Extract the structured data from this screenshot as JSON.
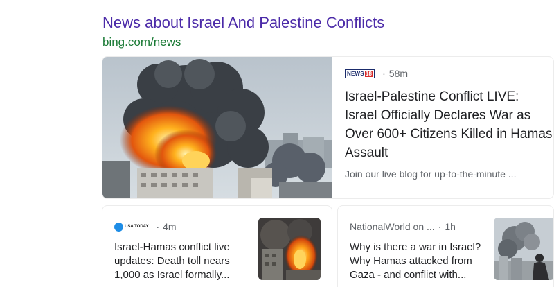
{
  "section": {
    "title": "News about Israel And Palestine Conflicts",
    "source": "bing.com/news"
  },
  "hero": {
    "source_logo_text": "NEWS",
    "source_logo_number": "18",
    "separator": "·",
    "time": "58m",
    "headline": "Israel-Palestine Conflict LIVE: Israel Officially Declares War as Over 600+ Citizens Killed in Hamas Assault",
    "snippet": "Join our live blog for up-to-the-minute ..."
  },
  "cards": [
    {
      "source_logo_text": "USA TODAY",
      "separator": "·",
      "time": "4m",
      "headline": "Israel-Hamas conflict live updates: Death toll nears 1,000 as Israel formally..."
    },
    {
      "source": "NationalWorld on ...",
      "separator": "·",
      "time": "1h",
      "headline": "Why is there a war in Israel? Why Hamas attacked from Gaza - and conflict with..."
    }
  ],
  "icons": {
    "hero_image": "explosion-photo",
    "card_a_image": "explosion-photo",
    "card_b_image": "smoke-city-photo",
    "usa_today_logo": "usa-today-logo",
    "news18_logo": "news18-logo"
  },
  "colors": {
    "title": "#4b2aa8",
    "source": "#1a7a35",
    "meta": "#5f6368",
    "headline": "#202124"
  }
}
